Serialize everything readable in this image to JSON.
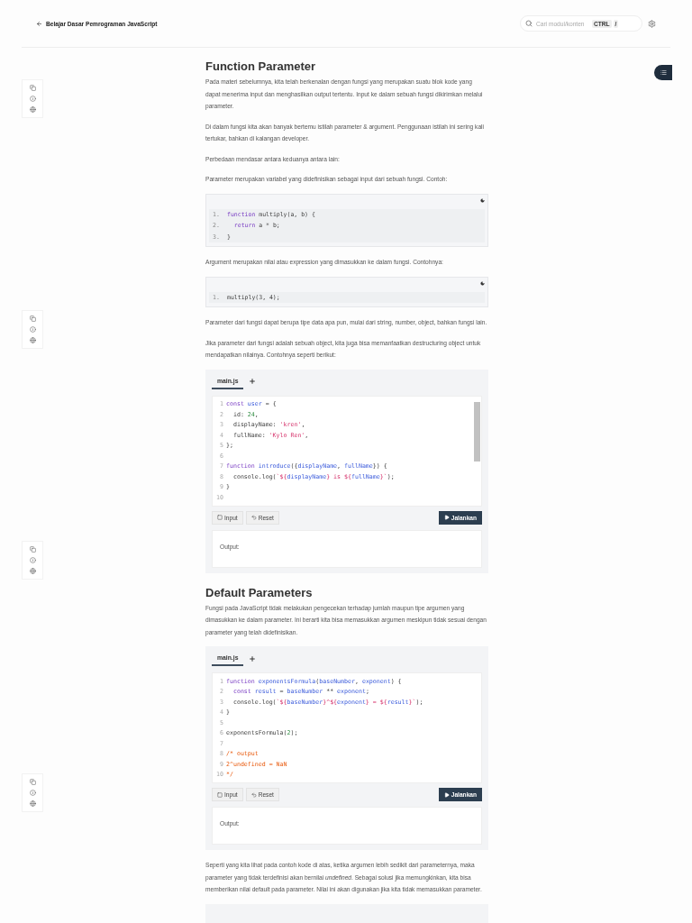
{
  "header": {
    "back_label": "Belajar Dasar Pemrograman JavaScript",
    "search": {
      "placeholder": "Cari modul/konten"
    },
    "shortcut_keys": [
      "CTRL",
      "/"
    ]
  },
  "sections": [
    {
      "title": "Function Parameter",
      "blocks": [
        {
          "kind": "paragraph",
          "text": "Pada materi sebelumnya, kita telah berkenalan dengan fungsi yang merupakan suatu blok kode yang dapat menerima input dan menghasilkan output tertentu. Input ke dalam sebuah fungsi dikirimkan melalui parameter."
        },
        {
          "kind": "paragraph",
          "text": "Di dalam fungsi kita akan banyak bertemu istilah parameter & argument. Penggunaan istilah ini sering kali tertukar, bahkan di kalangan developer."
        },
        {
          "kind": "paragraph",
          "text": "Perbedaan mendasar antara keduanya antara lain:"
        },
        {
          "kind": "paragraph",
          "text": "Parameter merupakan variabel yang didefinisikan sebagai input dari sebuah fungsi. Contoh:"
        },
        {
          "kind": "code",
          "lines": [
            {
              "number": "1.",
              "tokens": [
                {
                  "kind": "kw",
                  "t": "function"
                },
                {
                  "kind": "plain",
                  "t": " multiply(a, b) {"
                }
              ]
            },
            {
              "number": "2.",
              "tokens": [
                {
                  "kind": "kw",
                  "t": "  return"
                },
                {
                  "kind": "plain",
                  "t": " a * b;"
                }
              ]
            },
            {
              "number": "3.",
              "tokens": [
                {
                  "kind": "plain",
                  "t": "}"
                }
              ]
            }
          ]
        },
        {
          "kind": "paragraph",
          "text": "Argument merupakan nilai atau expression yang dimasukkan ke dalam fungsi. Contohnya:"
        },
        {
          "kind": "code",
          "lines": [
            {
              "number": "1.",
              "tokens": [
                {
                  "kind": "plain",
                  "t": "multiply(3, 4);"
                }
              ]
            }
          ]
        },
        {
          "kind": "paragraph",
          "text": "Parameter dari fungsi dapat berupa tipe data apa pun, mulai dari string, number, object, bahkan fungsi lain."
        },
        {
          "kind": "paragraph",
          "text": "Jika parameter dari fungsi adalah sebuah object, kita juga bisa memanfaatkan destructuring object untuk mendapatkan nilainya. Contohnya seperti berikut:"
        },
        {
          "kind": "editor",
          "tab": "main.js",
          "scrollbar": true,
          "buttons": [
            "Input",
            "Reset"
          ],
          "run_button": "Jalankan",
          "output_label": "Output:",
          "lines": [
            {
              "number": "1",
              "tokens": [
                {
                  "kind": "kw",
                  "t": "const"
                },
                {
                  "kind": "name",
                  "t": " user"
                },
                {
                  "kind": "plain",
                  "t": " = {"
                }
              ]
            },
            {
              "number": "2",
              "tokens": [
                {
                  "kind": "plain",
                  "t": "  id: "
                },
                {
                  "kind": "num",
                  "t": "24"
                },
                {
                  "kind": "plain",
                  "t": ","
                }
              ]
            },
            {
              "number": "3",
              "tokens": [
                {
                  "kind": "plain",
                  "t": "  displayName: "
                },
                {
                  "kind": "str",
                  "t": "'kren'"
                },
                {
                  "kind": "plain",
                  "t": ","
                }
              ]
            },
            {
              "number": "4",
              "tokens": [
                {
                  "kind": "plain",
                  "t": "  fullName: "
                },
                {
                  "kind": "str",
                  "t": "'Kylo Ren'"
                },
                {
                  "kind": "plain",
                  "t": ","
                }
              ]
            },
            {
              "number": "5",
              "tokens": [
                {
                  "kind": "plain",
                  "t": "};"
                }
              ]
            },
            {
              "number": "6"
            },
            {
              "number": "7",
              "tokens": [
                {
                  "kind": "kw",
                  "t": "function"
                },
                {
                  "kind": "name",
                  "t": " introduce"
                },
                {
                  "kind": "plain",
                  "t": "({"
                },
                {
                  "kind": "name",
                  "t": "displayName"
                },
                {
                  "kind": "plain",
                  "t": ", "
                },
                {
                  "kind": "name",
                  "t": "fullName"
                },
                {
                  "kind": "plain",
                  "t": "}) {"
                }
              ]
            },
            {
              "number": "8",
              "tokens": [
                {
                  "kind": "plain",
                  "t": "  console.log("
                },
                {
                  "kind": "str",
                  "t": "`${"
                },
                {
                  "kind": "name",
                  "t": "displayName"
                },
                {
                  "kind": "str",
                  "t": "} is ${"
                },
                {
                  "kind": "name",
                  "t": "fullName"
                },
                {
                  "kind": "str",
                  "t": "}`"
                },
                {
                  "kind": "plain",
                  "t": ");"
                }
              ]
            },
            {
              "number": "9",
              "tokens": [
                {
                  "kind": "plain",
                  "t": "}"
                }
              ]
            },
            {
              "number": "10"
            }
          ]
        }
      ]
    },
    {
      "title": "Default Parameters",
      "blocks": [
        {
          "kind": "paragraph",
          "text": "Fungsi pada JavaScript tidak melakukan pengecekan terhadap jumlah maupun tipe argumen yang dimasukkan ke dalam parameter. Ini berarti kita bisa memasukkan argumen meskipun tidak sesuai dengan parameter yang telah didefinisikan."
        },
        {
          "kind": "editor",
          "tab": "main.js",
          "scrollbar": false,
          "buttons": [
            "Input",
            "Reset"
          ],
          "run_button": "Jalankan",
          "output_label": "Output:",
          "lines": [
            {
              "number": "1",
              "tokens": [
                {
                  "kind": "kw",
                  "t": "function"
                },
                {
                  "kind": "name",
                  "t": " exponentsFormula"
                },
                {
                  "kind": "plain",
                  "t": "("
                },
                {
                  "kind": "name",
                  "t": "baseNumber"
                },
                {
                  "kind": "plain",
                  "t": ", "
                },
                {
                  "kind": "name",
                  "t": "exponent"
                },
                {
                  "kind": "plain",
                  "t": ") {"
                }
              ]
            },
            {
              "number": "2",
              "tokens": [
                {
                  "kind": "kw",
                  "t": "  const"
                },
                {
                  "kind": "name",
                  "t": " result"
                },
                {
                  "kind": "plain",
                  "t": " = "
                },
                {
                  "kind": "name",
                  "t": "baseNumber"
                },
                {
                  "kind": "plain",
                  "t": " ** "
                },
                {
                  "kind": "name",
                  "t": "exponent"
                },
                {
                  "kind": "plain",
                  "t": ";"
                }
              ]
            },
            {
              "number": "3",
              "tokens": [
                {
                  "kind": "plain",
                  "t": "  console.log("
                },
                {
                  "kind": "str",
                  "t": "`${"
                },
                {
                  "kind": "name",
                  "t": "baseNumber"
                },
                {
                  "kind": "str",
                  "t": "}^${"
                },
                {
                  "kind": "name",
                  "t": "exponent"
                },
                {
                  "kind": "str",
                  "t": "} = ${"
                },
                {
                  "kind": "name",
                  "t": "result"
                },
                {
                  "kind": "str",
                  "t": "}`"
                },
                {
                  "kind": "plain",
                  "t": ");"
                }
              ]
            },
            {
              "number": "4",
              "tokens": [
                {
                  "kind": "plain",
                  "t": "}"
                }
              ]
            },
            {
              "number": "5"
            },
            {
              "number": "6",
              "tokens": [
                {
                  "kind": "plain",
                  "t": "exponentsFormula("
                },
                {
                  "kind": "num",
                  "t": "2"
                },
                {
                  "kind": "plain",
                  "t": ");"
                }
              ]
            },
            {
              "number": "7"
            },
            {
              "number": "8",
              "tokens": [
                {
                  "kind": "comment",
                  "t": "/* output"
                }
              ]
            },
            {
              "number": "9",
              "tokens": [
                {
                  "kind": "comment",
                  "t": "2^undefined = NaN"
                }
              ]
            },
            {
              "number": "10",
              "tokens": [
                {
                  "kind": "comment",
                  "t": "*/"
                }
              ]
            }
          ]
        },
        {
          "kind": "paragraph",
          "text": "Seperti yang kita lihat pada contoh kode di atas, ketika argumen lebih sedikit dari parameternya, maka parameter yang tidak terdefinisi akan bernilai *undefined*. Sebagai solusi jika memungkinkan, kita bisa memberikan nilai default pada parameter. Nilai ini akan digunakan jika kita tidak memasukkan parameter."
        },
        {
          "kind": "cut_block"
        }
      ]
    }
  ]
}
